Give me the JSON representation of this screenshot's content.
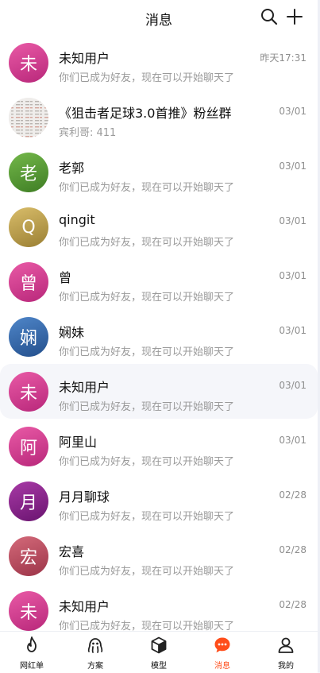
{
  "header": {
    "title": "消息"
  },
  "conversations": [
    {
      "initial": "未",
      "name": "未知用户",
      "preview": "你们已成为好友，现在可以开始聊天了",
      "time": "昨天17:31",
      "avatar_color_top": "#e95aa6",
      "avatar_color_bottom": "#b8277a"
    },
    {
      "initial": "",
      "name": "《狙击者足球3.0首推》粉丝群",
      "preview": "宾利哥: 411",
      "time": "03/01",
      "avatar_type": "group-image"
    },
    {
      "initial": "老",
      "name": "老郭",
      "preview": "你们已成为好友，现在可以开始聊天了",
      "time": "03/01",
      "avatar_color_top": "#74b84a",
      "avatar_color_bottom": "#3e7d24"
    },
    {
      "initial": "Q",
      "name": "qingit",
      "preview": "你们已成为好友，现在可以开始聊天了",
      "time": "03/01",
      "avatar_color_top": "#d9bd6a",
      "avatar_color_bottom": "#9a7f33"
    },
    {
      "initial": "曾",
      "name": "曾",
      "preview": "你们已成为好友，现在可以开始聊天了",
      "time": "03/01",
      "avatar_color_top": "#e95aa6",
      "avatar_color_bottom": "#b8277a"
    },
    {
      "initial": "娴",
      "name": "娴妹",
      "preview": "你们已成为好友，现在可以开始聊天了",
      "time": "03/01",
      "avatar_color_top": "#4f86c9",
      "avatar_color_bottom": "#234f8c"
    },
    {
      "initial": "未",
      "name": "未知用户",
      "preview": "你们已成为好友，现在可以开始聊天了",
      "time": "03/01",
      "avatar_color_top": "#e95aa6",
      "avatar_color_bottom": "#b8277a",
      "highlighted": true
    },
    {
      "initial": "阿",
      "name": "阿里山",
      "preview": "你们已成为好友，现在可以开始聊天了",
      "time": "03/01",
      "avatar_color_top": "#e95aa6",
      "avatar_color_bottom": "#b8277a"
    },
    {
      "initial": "月",
      "name": "月月聊球",
      "preview": "你们已成为好友，现在可以开始聊天了",
      "time": "02/28",
      "avatar_color_top": "#a83aa6",
      "avatar_color_bottom": "#6a1470"
    },
    {
      "initial": "宏",
      "name": "宏喜",
      "preview": "你们已成为好友，现在可以开始聊天了",
      "time": "02/28",
      "avatar_color_top": "#d46a7a",
      "avatar_color_bottom": "#9c3448"
    },
    {
      "initial": "未",
      "name": "未知用户",
      "preview": "你们已成为好友，现在可以开始聊天了",
      "time": "02/28",
      "avatar_color_top": "#e95aa6",
      "avatar_color_bottom": "#b8277a"
    }
  ],
  "tabbar": {
    "items": [
      {
        "label": "网红单",
        "icon": "flame-icon",
        "active": false
      },
      {
        "label": "方案",
        "icon": "octopus-icon",
        "active": false
      },
      {
        "label": "模型",
        "icon": "cube-icon",
        "active": false
      },
      {
        "label": "消息",
        "icon": "chat-bubble-icon",
        "active": true
      },
      {
        "label": "我的",
        "icon": "person-icon",
        "active": false
      }
    ],
    "active_color": "#ff4d1a"
  }
}
